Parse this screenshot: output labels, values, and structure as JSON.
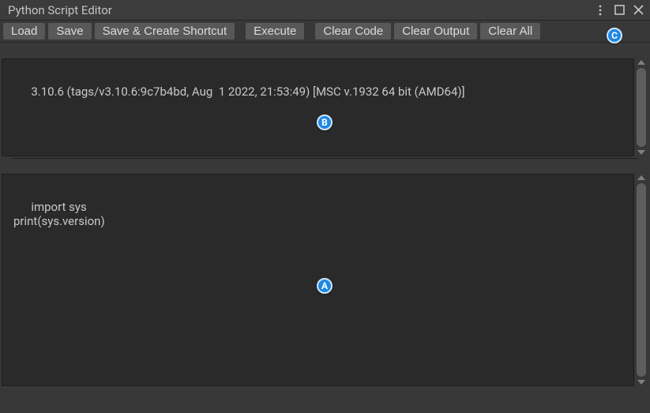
{
  "titlebar": {
    "title": "Python Script Editor"
  },
  "toolbar": {
    "load": "Load",
    "save": "Save",
    "save_shortcut": "Save & Create Shortcut",
    "execute": "Execute",
    "clear_code": "Clear Code",
    "clear_output": "Clear Output",
    "clear_all": "Clear All"
  },
  "output": {
    "text": "3.10.6 (tags/v3.10.6:9c7b4bd, Aug  1 2022, 21:53:49) [MSC v.1932 64 bit (AMD64)]"
  },
  "code": {
    "text": "import sys\nprint(sys.version)"
  },
  "badges": {
    "a": "A",
    "b": "B",
    "c": "C"
  }
}
